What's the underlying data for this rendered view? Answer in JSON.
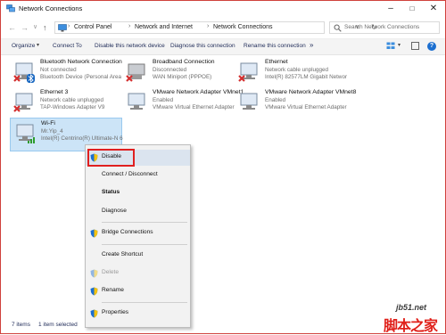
{
  "window": {
    "title": "Network Connections"
  },
  "address": {
    "crumbs": [
      "Control Panel",
      "Network and Internet",
      "Network Connections"
    ],
    "search_placeholder": "Search Network Connections"
  },
  "toolbar": {
    "organize": "Organize",
    "connect_to": "Connect To",
    "disable": "Disable this network device",
    "diagnose": "Diagnose this connection",
    "rename": "Rename this connection",
    "more": "»"
  },
  "connections": [
    {
      "name": "Bluetooth Network Connection",
      "status": "Not connected",
      "device": "Bluetooth Device (Personal Area ..."
    },
    {
      "name": "Broadband Connection",
      "status": "Disconnected",
      "device": "WAN Miniport (PPPOE)"
    },
    {
      "name": "Ethernet",
      "status": "Network cable unplugged",
      "device": "Intel(R) 82577LM Gigabit Network ..."
    },
    {
      "name": "Ethernet 3",
      "status": "Network cable unplugged",
      "device": "TAP-Windows Adapter V9"
    },
    {
      "name": "VMware Network Adapter VMnet1",
      "status": "Enabled",
      "device": "VMware Virtual Ethernet Adapter ..."
    },
    {
      "name": "VMware Network Adapter VMnet8",
      "status": "Enabled",
      "device": "VMware Virtual Ethernet Adapter ..."
    },
    {
      "name": "Wi-Fi",
      "status": "Mr.Yip_4",
      "device": "Intel(R) Centrino(R) Ultimate-N 6..."
    }
  ],
  "context_menu": {
    "items": [
      {
        "label": "Disable"
      },
      {
        "label": "Connect / Disconnect"
      },
      {
        "label": "Status"
      },
      {
        "label": "Diagnose"
      },
      {
        "label": "Bridge Connections"
      },
      {
        "label": "Create Shortcut"
      },
      {
        "label": "Delete"
      },
      {
        "label": "Rename"
      },
      {
        "label": "Properties"
      }
    ]
  },
  "statusbar": {
    "count": "7 items",
    "selected": "1 item selected"
  },
  "watermark": {
    "site": "jb51.net",
    "name": "脚本之家"
  },
  "icons": {
    "app": "network-connections-icon",
    "computer": "computer-icon",
    "search": "search-icon",
    "shield": "uac-shield-icon",
    "help": "help-icon"
  },
  "colors": {
    "accent": "#1c6fd0",
    "selection": "#cce4f7",
    "highlight_box": "#e02020",
    "error_x": "#d32f2f"
  }
}
